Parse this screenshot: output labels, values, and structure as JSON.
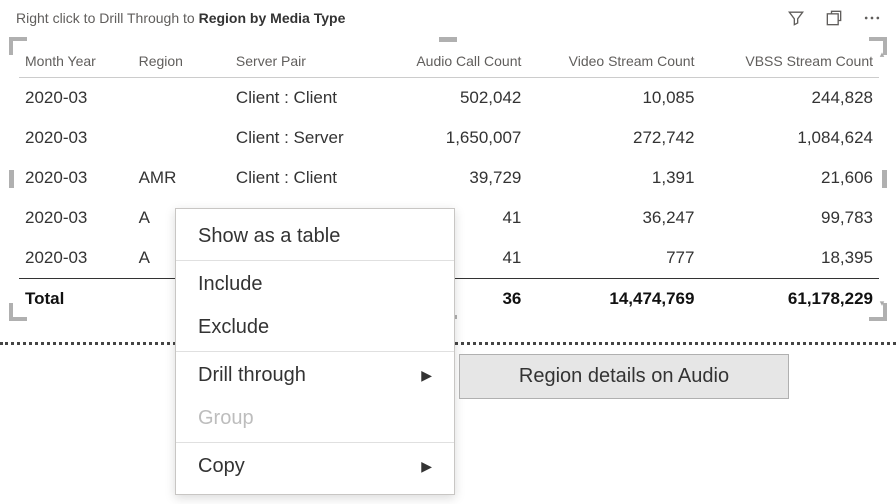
{
  "header": {
    "hint_prefix": "Right click to Drill Through to ",
    "hint_bold": "Region by Media Type"
  },
  "columns": [
    "Month Year",
    "Region",
    "Server Pair",
    "Audio Call Count",
    "Video Stream Count",
    "VBSS Stream Count"
  ],
  "rows": [
    {
      "month": "2020-03",
      "region": "",
      "sp": "Client : Client",
      "ac": "502,042",
      "vs": "10,085",
      "vb": "244,828"
    },
    {
      "month": "2020-03",
      "region": "",
      "sp": "Client : Server",
      "ac": "1,650,007",
      "vs": "272,742",
      "vb": "1,084,624"
    },
    {
      "month": "2020-03",
      "region": "AMR",
      "sp": "Client : Client",
      "ac": "39,729",
      "vs": "1,391",
      "vb": "21,606"
    },
    {
      "month": "2020-03",
      "region": "A",
      "sp": "",
      "ac": "41",
      "vs": "36,247",
      "vb": "99,783"
    },
    {
      "month": "2020-03",
      "region": "A",
      "sp": "",
      "ac": "41",
      "vs": "777",
      "vb": "18,395"
    }
  ],
  "total": {
    "label": "Total",
    "ac": "36",
    "vs": "14,474,769",
    "vb": "61,178,229"
  },
  "menu": {
    "show_table": "Show as a table",
    "include": "Include",
    "exclude": "Exclude",
    "drill": "Drill through",
    "group": "Group",
    "copy": "Copy"
  },
  "submenu": {
    "region_audio": "Region details on Audio"
  }
}
